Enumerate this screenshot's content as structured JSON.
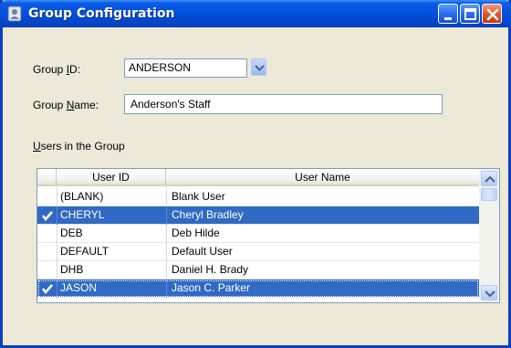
{
  "window": {
    "title": "Group Configuration",
    "icon": "user-shield-icon"
  },
  "form": {
    "group_id_label_pre": "Group ",
    "group_id_label_accel": "I",
    "group_id_label_post": "D:",
    "group_id_value": "ANDERSON",
    "group_name_label_pre": "Group ",
    "group_name_label_accel": "N",
    "group_name_label_post": "ame:",
    "group_name_value": "Anderson's Staff",
    "users_label_accel": "U",
    "users_label_post": "sers in the Group"
  },
  "grid": {
    "columns": [
      "User ID",
      "User Name"
    ],
    "rows": [
      {
        "id": "(BLANK)",
        "name": "Blank User",
        "checked": false
      },
      {
        "id": "CHERYL",
        "name": "Cheryl Bradley",
        "checked": true
      },
      {
        "id": "DEB",
        "name": "Deb Hilde",
        "checked": false
      },
      {
        "id": "DEFAULT",
        "name": "Default User",
        "checked": false
      },
      {
        "id": "DHB",
        "name": "Daniel H. Brady",
        "checked": false
      },
      {
        "id": "JASON",
        "name": "Jason C. Parker",
        "checked": true
      }
    ]
  },
  "colors": {
    "selection": "#316ac5",
    "titlebar": "#0552de",
    "dialog_bg": "#ece9d8"
  }
}
